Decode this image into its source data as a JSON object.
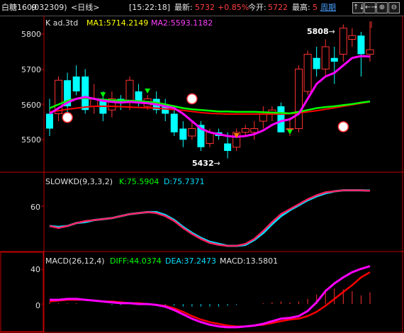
{
  "header": {
    "name": "白糖1609",
    "code": "(032309)",
    "period": "<日线>",
    "time": "[15:22:18]",
    "last_label": "最新:",
    "last_value": "5732",
    "change": "+0.85%",
    "open_label": "今开:",
    "open_value": "5722",
    "high_label": "最高:",
    "high_value": "5",
    "period_link": "周期"
  },
  "nav_buttons": [
    "↑↓",
    "←→",
    "⊕",
    "⊖"
  ],
  "colors": {
    "up": "#ff3232",
    "down": "#00ffff",
    "ma1": "#ff00ff",
    "ma2": "#00ff00",
    "ma_red": "#ff0000",
    "axis": "#c00000",
    "text": "#e0e0e0",
    "label_yellow": "#ffff00",
    "label_cyan": "#00e0ff"
  },
  "panels": {
    "main": {
      "caption_k": "K ad.3td",
      "ma1_label": "MA1:5714.2149",
      "ma2_label": "MA2:5593.1182",
      "y_ticks": [
        "5800",
        "5700",
        "5600",
        "5500"
      ],
      "annot_high": "5808",
      "annot_low": "5432"
    },
    "kd": {
      "caption": "SLOWKD(9,3,3,2)",
      "k_label": "K:75.5904",
      "d_label": "D:75.7371",
      "y_ticks": [
        "60"
      ]
    },
    "macd": {
      "caption": "MACD(26,12,4)",
      "diff_label": "DIFF:44.0374",
      "dea_label": "DEA:37.2473",
      "macd_label": "MACD:13.5801",
      "y_ticks": [
        "40",
        "0"
      ]
    }
  },
  "chart_data": [
    {
      "type": "candlestick",
      "title": "K ad.3td",
      "ylim": [
        5420,
        5820
      ],
      "y_ticks": [
        5500,
        5600,
        5700,
        5800
      ],
      "candles": [
        [
          5560,
          5600,
          5500,
          5520
        ],
        [
          5560,
          5660,
          5540,
          5650
        ],
        [
          5650,
          5670,
          5560,
          5580
        ],
        [
          5660,
          5690,
          5610,
          5620
        ],
        [
          5660,
          5680,
          5560,
          5570
        ],
        [
          5580,
          5640,
          5560,
          5600
        ],
        [
          5600,
          5620,
          5540,
          5560
        ],
        [
          5570,
          5620,
          5550,
          5600
        ],
        [
          5600,
          5610,
          5570,
          5590
        ],
        [
          5590,
          5660,
          5570,
          5650
        ],
        [
          5620,
          5640,
          5580,
          5590
        ],
        [
          5580,
          5610,
          5570,
          5600
        ],
        [
          5600,
          5620,
          5560,
          5570
        ],
        [
          5580,
          5600,
          5540,
          5560
        ],
        [
          5560,
          5570,
          5500,
          5510
        ],
        [
          5520,
          5540,
          5470,
          5490
        ],
        [
          5500,
          5540,
          5490,
          5520
        ],
        [
          5530,
          5540,
          5460,
          5470
        ],
        [
          5480,
          5520,
          5470,
          5510
        ],
        [
          5510,
          5520,
          5490,
          5500
        ],
        [
          5480,
          5510,
          5440,
          5460
        ],
        [
          5470,
          5520,
          5460,
          5510
        ],
        [
          5510,
          5530,
          5500,
          5520
        ],
        [
          5510,
          5540,
          5490,
          5520
        ],
        [
          5540,
          5580,
          5520,
          5560
        ],
        [
          5560,
          5580,
          5540,
          5570
        ],
        [
          5580,
          5590,
          5510,
          5510
        ],
        [
          5520,
          5550,
          5500,
          5520
        ],
        [
          5520,
          5690,
          5510,
          5680
        ],
        [
          5620,
          5730,
          5610,
          5720
        ],
        [
          5710,
          5740,
          5660,
          5680
        ],
        [
          5680,
          5760,
          5660,
          5740
        ],
        [
          5710,
          5740,
          5640,
          5700
        ],
        [
          5720,
          5800,
          5700,
          5790
        ],
        [
          5760,
          5790,
          5740,
          5770
        ],
        [
          5770,
          5780,
          5660,
          5720
        ],
        [
          5720,
          5808,
          5700,
          5732
        ]
      ],
      "series": [
        {
          "name": "MA1",
          "values": [
            5560,
            5575,
            5590,
            5600,
            5605,
            5600,
            5595,
            5592,
            5590,
            5592,
            5590,
            5588,
            5585,
            5580,
            5575,
            5560,
            5540,
            5520,
            5510,
            5505,
            5500,
            5498,
            5500,
            5505,
            5515,
            5530,
            5540,
            5545,
            5560,
            5600,
            5640,
            5660,
            5670,
            5690,
            5710,
            5715,
            5714
          ]
        },
        {
          "name": "MA2",
          "values": [
            5575,
            5585,
            5595,
            5600,
            5602,
            5600,
            5598,
            5596,
            5596,
            5595,
            5594,
            5592,
            5590,
            5585,
            5580,
            5575,
            5572,
            5570,
            5568,
            5566,
            5566,
            5565,
            5565,
            5565,
            5564,
            5563,
            5562,
            5561,
            5565,
            5570,
            5575,
            5578,
            5580,
            5583,
            5586,
            5590,
            5593
          ]
        }
      ]
    },
    {
      "type": "line",
      "title": "SLOWKD(9,3,3,2)",
      "ylim": [
        15,
        85
      ],
      "y_ticks": [
        60
      ],
      "series": [
        {
          "name": "K",
          "values": [
            40,
            38,
            40,
            43,
            45,
            46,
            47,
            48,
            50,
            52,
            53,
            54,
            53,
            50,
            45,
            38,
            32,
            27,
            23,
            21,
            20,
            20,
            22,
            27,
            35,
            44,
            52,
            57,
            62,
            67,
            71,
            74,
            75,
            76,
            76,
            76,
            75.6
          ]
        },
        {
          "name": "D",
          "values": [
            40,
            39,
            40,
            43,
            44,
            46,
            47,
            48,
            50,
            52,
            53,
            54,
            54,
            51,
            46,
            39,
            33,
            28,
            24,
            22,
            20,
            20,
            21,
            26,
            33,
            42,
            50,
            56,
            61,
            66,
            70,
            73,
            75,
            76,
            76,
            76,
            75.7
          ]
        }
      ]
    },
    {
      "type": "line",
      "title": "MACD(26,12,4)",
      "ylim": [
        -32,
        52
      ],
      "y_ticks": [
        0,
        40
      ],
      "series": [
        {
          "name": "DIFF",
          "values": [
            5,
            5,
            6,
            6,
            5,
            4,
            3,
            2,
            1,
            1,
            0,
            0,
            -1,
            -3,
            -7,
            -12,
            -17,
            -21,
            -24,
            -26,
            -27,
            -27,
            -26,
            -25,
            -23,
            -20,
            -17,
            -16,
            -14,
            -8,
            2,
            15,
            24,
            31,
            37,
            41,
            44
          ]
        },
        {
          "name": "DEA",
          "values": [
            3,
            4,
            5,
            5,
            5,
            4,
            3,
            3,
            2,
            1,
            1,
            0,
            -1,
            -2,
            -5,
            -9,
            -14,
            -18,
            -21,
            -23,
            -25,
            -26,
            -26,
            -25,
            -24,
            -22,
            -20,
            -18,
            -17,
            -14,
            -9,
            -2,
            6,
            14,
            22,
            31,
            37
          ]
        },
        {
          "name": "MACD",
          "values": [
            2,
            1,
            1,
            1,
            0,
            0,
            0,
            -1,
            -1,
            0,
            -1,
            0,
            0,
            -1,
            -2,
            -3,
            -3,
            -3,
            -3,
            -3,
            -2,
            -1,
            0,
            0,
            1,
            2,
            3,
            2,
            3,
            6,
            11,
            17,
            18,
            17,
            15,
            10,
            13.6
          ]
        }
      ]
    }
  ]
}
